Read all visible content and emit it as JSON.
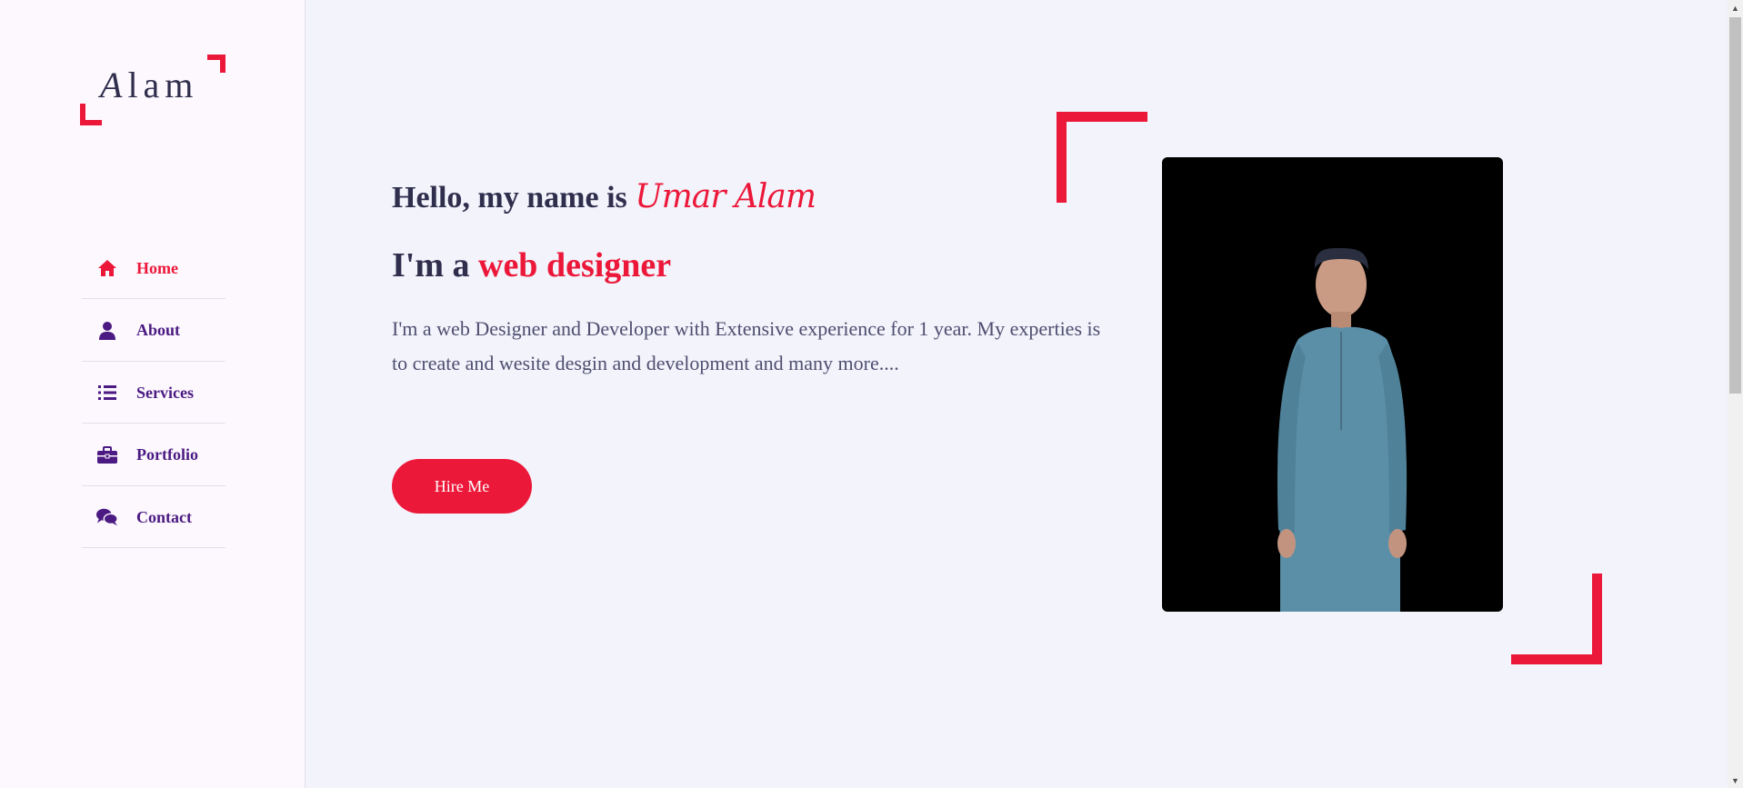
{
  "logo": {
    "first_letter": "A",
    "rest": "lam"
  },
  "nav": {
    "items": [
      {
        "label": "Home",
        "icon": "home-icon",
        "active": true
      },
      {
        "label": "About",
        "icon": "user-icon",
        "active": false
      },
      {
        "label": "Services",
        "icon": "list-icon",
        "active": false
      },
      {
        "label": "Portfolio",
        "icon": "briefcase-icon",
        "active": false
      },
      {
        "label": "Contact",
        "icon": "chat-icon",
        "active": false
      }
    ]
  },
  "hero": {
    "greeting": "Hello, my name is",
    "name": "Umar Alam",
    "role_prefix": "I'm a",
    "role": "web designer",
    "description": "I'm a web Designer and Developer with Extensive experience for 1 year. My experties is to create and wesite desgin and development and many more....",
    "cta_label": "Hire Me"
  },
  "colors": {
    "accent": "#ec1839",
    "nav_text": "#4b1a82",
    "heading": "#302e4d",
    "body_text": "#504e70",
    "sidebar_bg": "#fcf8fe",
    "page_bg": "#f2f3fb"
  },
  "photo": {
    "alt_subject": "portrait-photo"
  }
}
